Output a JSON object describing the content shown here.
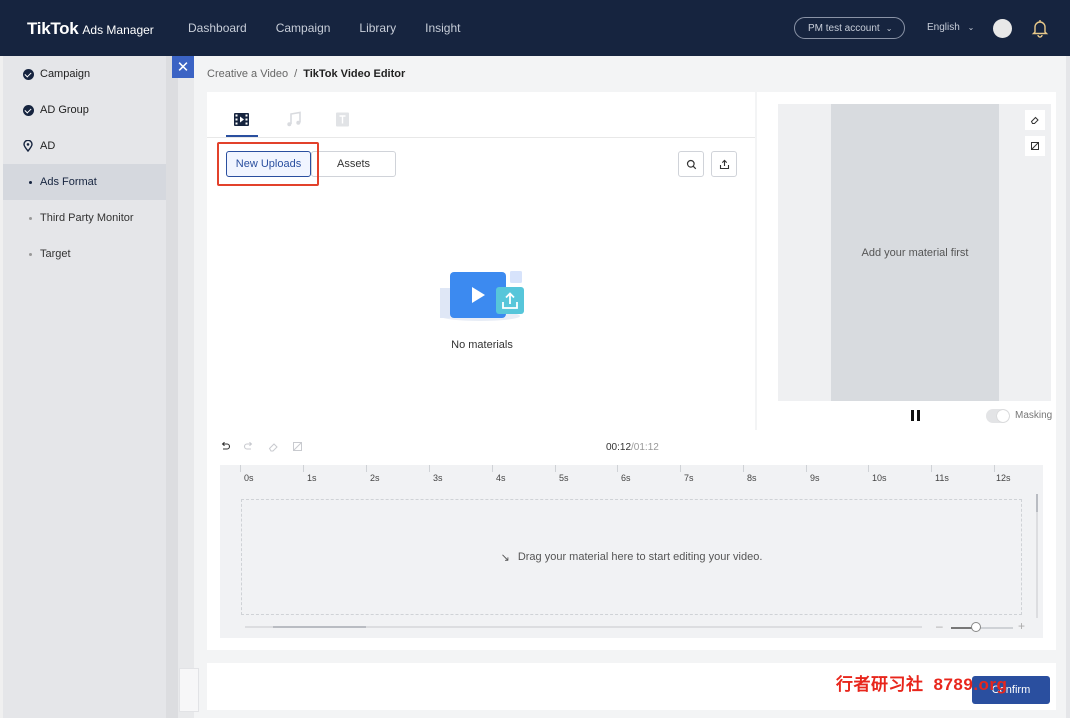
{
  "header": {
    "brand_logo": "TikTok",
    "brand_sub": "Ads Manager",
    "nav": [
      "Dashboard",
      "Campaign",
      "Library",
      "Insight"
    ],
    "account": "PM test account",
    "language": "English"
  },
  "sidebar": {
    "items": [
      {
        "label": "Campaign"
      },
      {
        "label": "AD Group"
      },
      {
        "label": "AD"
      },
      {
        "label": "Ads Format"
      },
      {
        "label": "Third Party Monitor"
      },
      {
        "label": "Target"
      }
    ]
  },
  "breadcrumb": {
    "parent": "Creative a Video",
    "separator": "/",
    "current": "TikTok Video Editor"
  },
  "library": {
    "new_uploads": "New Uploads",
    "assets": "Assets",
    "empty_text": "No materials"
  },
  "preview": {
    "placeholder": "Add your material first",
    "masking": "Masking"
  },
  "timeline": {
    "current": "00:12",
    "total": "/01:12",
    "ticks": [
      "0s",
      "1s",
      "2s",
      "3s",
      "4s",
      "5s",
      "6s",
      "7s",
      "8s",
      "9s",
      "10s",
      "11s",
      "12s"
    ],
    "drop_hint": "Drag your material here to start editing your video."
  },
  "footer": {
    "confirm": "Confirm"
  },
  "watermark": {
    "text": "行者研习社",
    "num": "8789.org"
  },
  "icons": {
    "close": "close-icon",
    "search": "search-icon",
    "upload": "upload-icon",
    "video_tab": "video-tab-icon",
    "music_tab": "music-tab-icon",
    "text_tab": "text-tab-icon"
  },
  "colors": {
    "topbar": "#16243f",
    "accent": "#2a4f9f",
    "highlight": "#e2412b",
    "watermark": "#e8261c"
  }
}
